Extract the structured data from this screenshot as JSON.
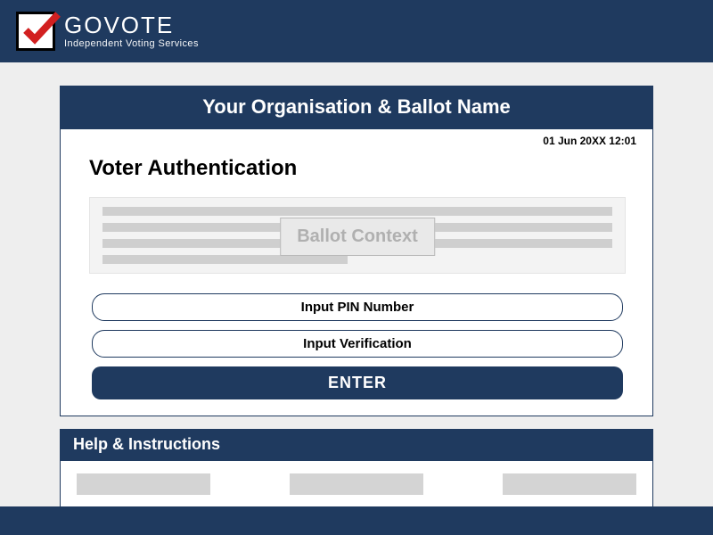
{
  "brand": {
    "name": "GOVOTE",
    "tagline": "Independent Voting Services"
  },
  "card": {
    "header": "Your Organisation & Ballot Name",
    "timestamp": "01 Jun 20XX 12:01",
    "title": "Voter Authentication",
    "context_label": "Ballot Context"
  },
  "inputs": {
    "pin_placeholder": "Input PIN Number",
    "verification_placeholder": "Input Verification",
    "enter_label": "ENTER"
  },
  "help": {
    "header": "Help & Instructions"
  },
  "colors": {
    "primary": "#1f3a5f",
    "accent_check": "#d22020"
  }
}
